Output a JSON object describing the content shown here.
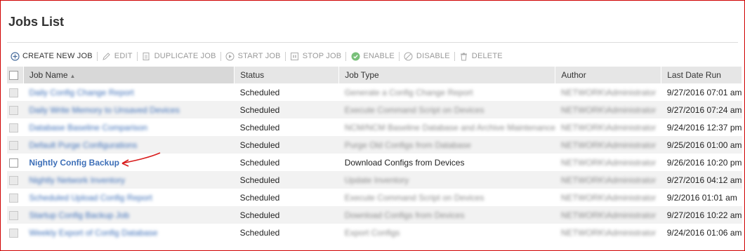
{
  "page": {
    "title": "Jobs List"
  },
  "toolbar": {
    "create": "CREATE NEW JOB",
    "edit": "EDIT",
    "duplicate": "DUPLICATE JOB",
    "start": "START JOB",
    "stop": "STOP JOB",
    "enable": "ENABLE",
    "disable": "DISABLE",
    "delete": "DELETE"
  },
  "columns": {
    "name": "Job Name",
    "status": "Status",
    "type": "Job Type",
    "author": "Author",
    "last_run": "Last Date Run"
  },
  "rows": [
    {
      "name": "Daily Config Change Report",
      "status": "Scheduled",
      "type": "Generate a Config Change Report",
      "author": "NETWORK\\Administrator",
      "last_run": "9/27/2016 07:01 am"
    },
    {
      "name": "Daily Write Memory to Unsaved Devices",
      "status": "Scheduled",
      "type": "Execute Command Script on Devices",
      "author": "NETWORK\\Administrator",
      "last_run": "9/27/2016 07:24 am"
    },
    {
      "name": "Database Baseline Comparison",
      "status": "Scheduled",
      "type": "NCM/NCM Baseline Database and Archive Maintenance",
      "author": "NETWORK\\Administrator",
      "last_run": "9/24/2016 12:37 pm"
    },
    {
      "name": "Default Purge Configurations",
      "status": "Scheduled",
      "type": "Purge Old Configs from Database",
      "author": "NETWORK\\Administrator",
      "last_run": "9/25/2016 01:00 am"
    },
    {
      "name": "Nightly Config Backup",
      "status": "Scheduled",
      "type": "Download Configs from Devices",
      "author": "NETWORK\\Administrator",
      "last_run": "9/26/2016 10:20 pm",
      "clear": true
    },
    {
      "name": "Nightly Network Inventory",
      "status": "Scheduled",
      "type": "Update Inventory",
      "author": "NETWORK\\Administrator",
      "last_run": "9/27/2016 04:12 am"
    },
    {
      "name": "Scheduled Upload Config Report",
      "status": "Scheduled",
      "type": "Execute Command Script on Devices",
      "author": "NETWORK\\Administrator",
      "last_run": "9/2/2016 01:01 am"
    },
    {
      "name": "Startup Config Backup Job",
      "status": "Scheduled",
      "type": "Download Configs from Devices",
      "author": "NETWORK\\Administrator",
      "last_run": "9/27/2016 10:22 am"
    },
    {
      "name": "Weekly Export of Config Database",
      "status": "Scheduled",
      "type": "Export Configs",
      "author": "NETWORK\\Administrator",
      "last_run": "9/24/2016 01:06 am"
    }
  ],
  "colors": {
    "border": "#d00000",
    "link": "#3d6fb8",
    "annotation": "#d81b1b",
    "enable_icon": "#4caf50"
  },
  "icons": [
    "plus-circle-icon",
    "pencil-icon",
    "duplicate-icon",
    "play-icon",
    "stop-icon",
    "check-circle-icon",
    "disable-circle-icon",
    "trash-icon",
    "sort-asc-icon"
  ]
}
